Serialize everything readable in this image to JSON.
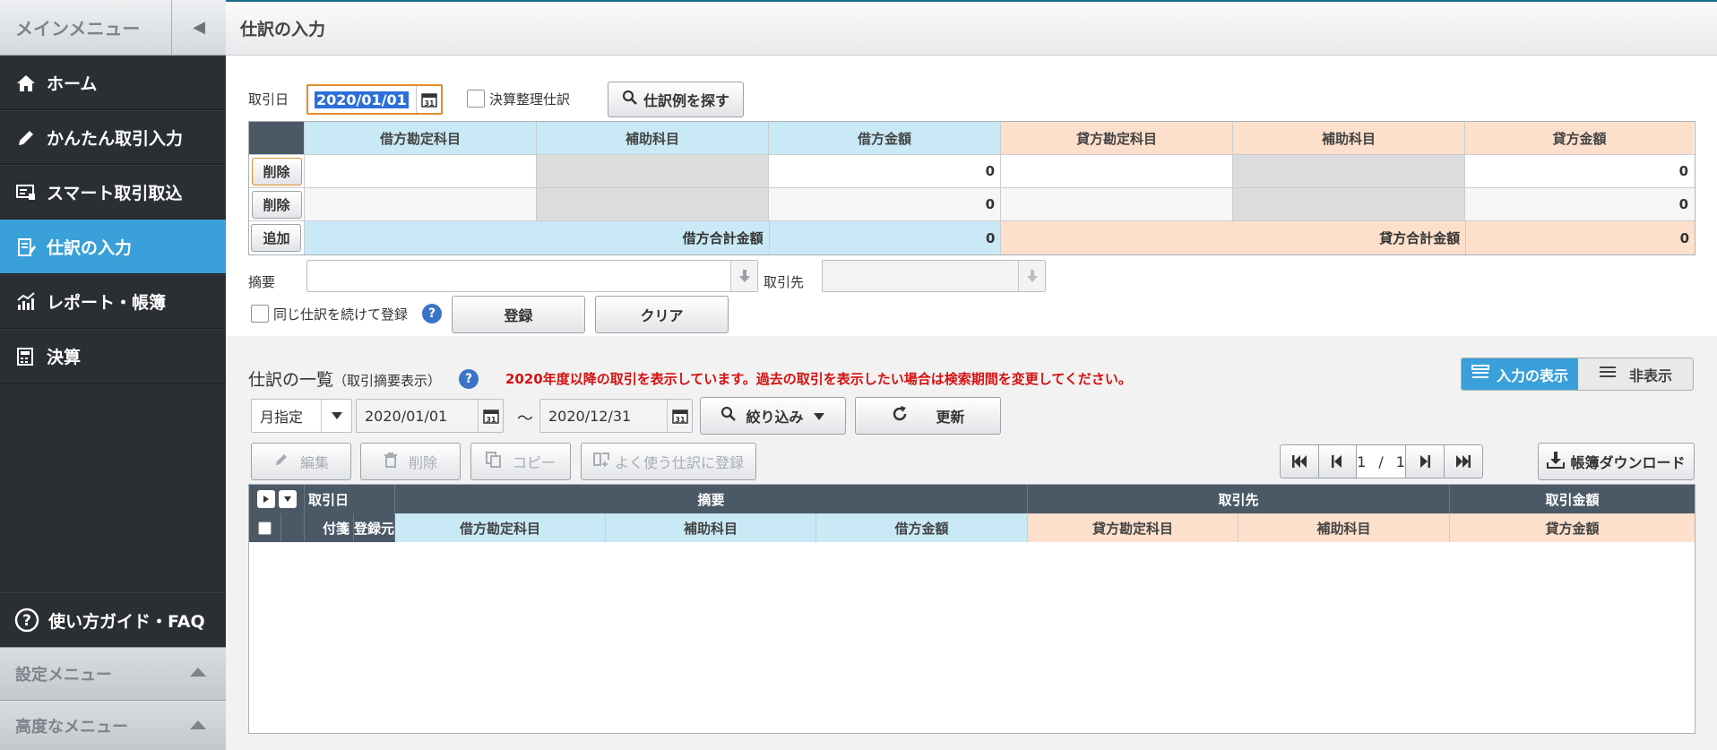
{
  "sidebar": {
    "title": "メインメニュー",
    "items": [
      {
        "label": "ホーム",
        "icon": "home-icon"
      },
      {
        "label": "かんたん取引入力",
        "icon": "pencil-icon"
      },
      {
        "label": "スマート取引取込",
        "icon": "import-icon"
      },
      {
        "label": "仕訳の入力",
        "icon": "journal-icon",
        "active": true
      },
      {
        "label": "レポート・帳簿",
        "icon": "report-icon"
      },
      {
        "label": "決算",
        "icon": "settlement-icon"
      }
    ],
    "guide": "使い方ガイド・FAQ",
    "settings_menu": "設定メニュー",
    "advanced_menu": "高度なメニュー"
  },
  "header": {
    "title": "仕訳の入力"
  },
  "entry": {
    "date_label": "取引日",
    "date_value": "2020/01/01",
    "adjust_label": "決算整理仕訳",
    "find_example": "仕訳例を探す",
    "table": {
      "headers": [
        "借方勘定科目",
        "補助科目",
        "借方金額",
        "貸方勘定科目",
        "補助科目",
        "貸方金額"
      ],
      "rows": [
        {
          "button": "削除",
          "debit_amount": "0",
          "credit_amount": "0"
        },
        {
          "button": "削除",
          "debit_amount": "0",
          "credit_amount": "0"
        }
      ],
      "add_button": "追加",
      "debit_total_label": "借方合計金額",
      "debit_total": "0",
      "credit_total_label": "貸方合計金額",
      "credit_total": "0"
    },
    "memo_label": "摘要",
    "partner_label": "取引先",
    "repeat_label": "同じ仕訳を続けて登録",
    "register_button": "登録",
    "clear_button": "クリア"
  },
  "list": {
    "title": "仕訳の一覧",
    "title_sub": "（取引摘要表示）",
    "warning": "2020年度以降の取引を表示しています。過去の取引を表示したい場合は検索期間を変更してください。",
    "toggle_on": "入力の表示",
    "toggle_off": "非表示",
    "period_mode": "月指定",
    "date_from": "2020/01/01",
    "tilde": "～",
    "date_to": "2020/12/31",
    "filter_button": "絞り込み",
    "refresh_button": "更新",
    "edit_button": "編集",
    "delete_button": "削除",
    "copy_button": "コピー",
    "favorite_button": "よく使う仕訳に登録",
    "page_current": "1",
    "page_sep": "/",
    "page_total": "1",
    "download_button": "帳簿ダウンロード",
    "header1": [
      "取引日",
      "摘要",
      "取引先",
      "取引金額"
    ],
    "header2": [
      "付箋",
      "登録元",
      "借方勘定科目",
      "補助科目",
      "借方金額",
      "貸方勘定科目",
      "補助科目",
      "貸方金額"
    ]
  },
  "colors": {
    "accent": "#3aa0d9",
    "sidebar_bg": "#2b2f33",
    "debit_header": "#c9e9f6",
    "credit_header": "#fde0cc",
    "warning": "#d41111"
  }
}
